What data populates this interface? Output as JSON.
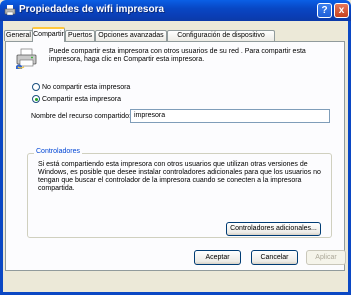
{
  "window": {
    "title": "Propiedades de wifi impresora",
    "help": "?",
    "close": "x"
  },
  "tabs": [
    "General",
    "Compartir",
    "Puertos",
    "Opciones avanzadas",
    "Configuración de dispositivo"
  ],
  "intro": "Puede compartir esta impresora con otros usuarios de su red . Para compartir esta impresora, haga clic en Compartir esta impresora.",
  "options": {
    "no_share": "No compartir esta impresora",
    "share": "Compartir esta impresora"
  },
  "share_name": {
    "label": "Nombre del recurso compartido:",
    "value": "impresora"
  },
  "drivers": {
    "legend": "Controladores",
    "text": "Si está compartiendo esta impresora con otros usuarios que utilizan otras versiones de Windows, es posible que desee instalar controladores adicionales para que los usuarios no tengan que buscar el controlador de la impresora cuando se conecten a la impresora compartida.",
    "button": "Controladores adicionales..."
  },
  "buttons": {
    "ok": "Aceptar",
    "cancel": "Cancelar",
    "apply": "Aplicar"
  },
  "colors": {
    "titlebar": "#0a3fb8",
    "dialog_bg": "#ece9d8",
    "legend": "#0046d5",
    "radio_dot": "#21a121"
  },
  "icons": {
    "window": "printer-icon",
    "intro": "shared-printer-icon"
  }
}
